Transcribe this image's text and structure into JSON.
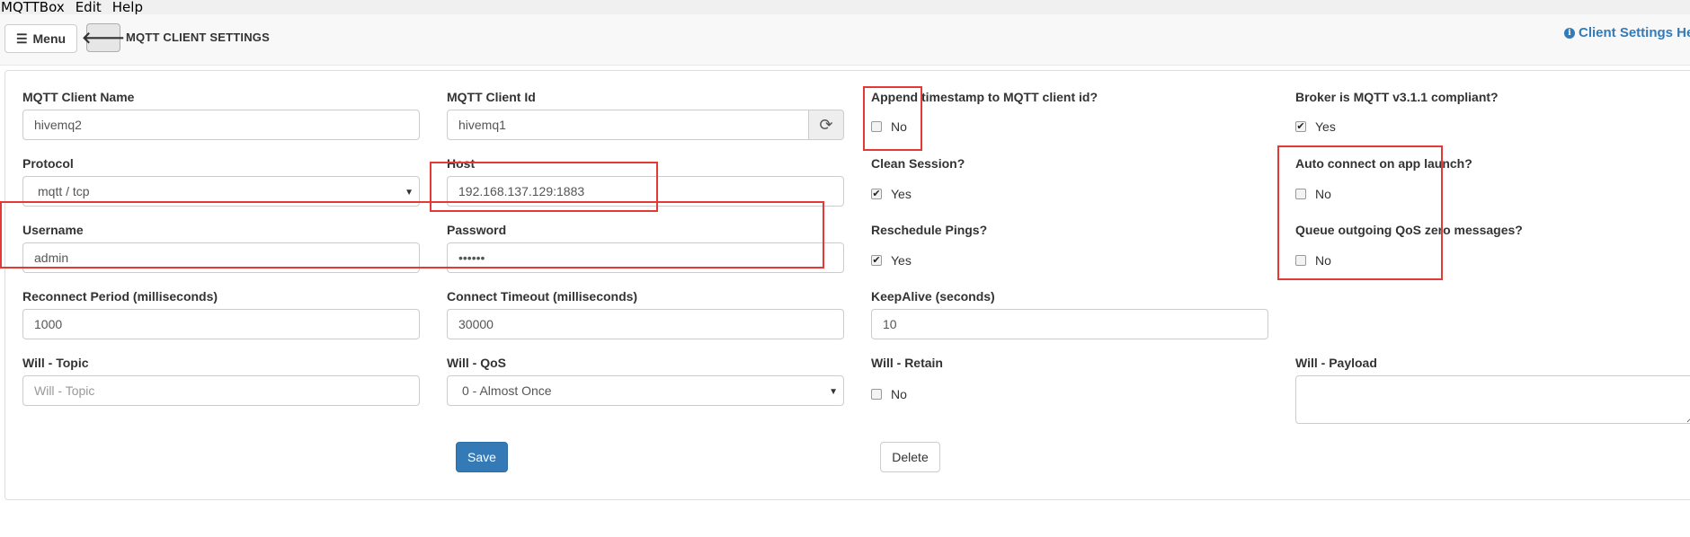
{
  "menubar": {
    "items": [
      "MQTTBox",
      "Edit",
      "Help"
    ]
  },
  "topbar": {
    "menu_label": "Menu",
    "title": "MQTT CLIENT SETTINGS",
    "help_label": "Client Settings He"
  },
  "form": {
    "client_name": {
      "label": "MQTT Client Name",
      "value": "hivemq2"
    },
    "client_id": {
      "label": "MQTT Client Id",
      "value": "hivemq1"
    },
    "append_timestamp": {
      "label": "Append timestamp to MQTT client id?",
      "option": "No",
      "checked": false
    },
    "broker_compliant": {
      "label": "Broker is MQTT v3.1.1 compliant?",
      "option": "Yes",
      "checked": true
    },
    "protocol": {
      "label": "Protocol",
      "value": "mqtt / tcp"
    },
    "host": {
      "label": "Host",
      "value": "192.168.137.129:1883"
    },
    "clean_session": {
      "label": "Clean Session?",
      "option": "Yes",
      "checked": true
    },
    "auto_connect": {
      "label": "Auto connect on app launch?",
      "option": "No",
      "checked": false
    },
    "username": {
      "label": "Username",
      "value": "admin"
    },
    "password": {
      "label": "Password",
      "value": "••••••"
    },
    "reschedule_pings": {
      "label": "Reschedule Pings?",
      "option": "Yes",
      "checked": true
    },
    "queue_qos_zero": {
      "label": "Queue outgoing QoS zero messages?",
      "option": "No",
      "checked": false
    },
    "reconnect_period": {
      "label": "Reconnect Period (milliseconds)",
      "value": "1000"
    },
    "connect_timeout": {
      "label": "Connect Timeout (milliseconds)",
      "value": "30000"
    },
    "keepalive": {
      "label": "KeepAlive (seconds)",
      "value": "10"
    },
    "will_topic": {
      "label": "Will - Topic",
      "placeholder": "Will - Topic"
    },
    "will_qos": {
      "label": "Will - QoS",
      "value": "0 - Almost Once"
    },
    "will_retain": {
      "label": "Will - Retain",
      "option": "No",
      "checked": false
    },
    "will_payload": {
      "label": "Will - Payload"
    },
    "save_label": "Save",
    "delete_label": "Delete"
  },
  "colors": {
    "primary": "#337ab7",
    "highlight": "#e53935"
  }
}
